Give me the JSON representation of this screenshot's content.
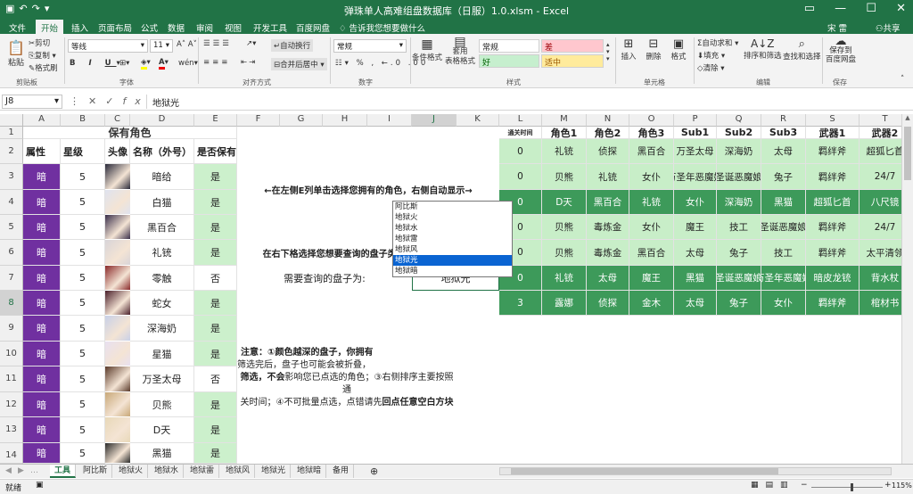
{
  "window": {
    "title": "弹珠单人高难组盘数据库（日服）1.0.xlsm - Excel",
    "user": "宋 雷",
    "share": "共享",
    "save_icon": "save-icon"
  },
  "ribbon_tabs": [
    "文件",
    "开始",
    "插入",
    "页面布局",
    "公式",
    "数据",
    "审阅",
    "视图",
    "开发工具",
    "百度网盘"
  ],
  "ribbon_tab_active": "开始",
  "tell_me": "告诉我您想要做什么",
  "ribbon": {
    "clipboard": {
      "paste": "粘贴",
      "cut": "剪切",
      "copy": "复制",
      "format_painter": "格式刷",
      "label": "剪贴板"
    },
    "font": {
      "name": "等线",
      "size": "11",
      "label": "字体"
    },
    "alignment": {
      "wrap": "自动换行",
      "merge": "合并后居中",
      "label": "对齐方式"
    },
    "number": {
      "format": "常规",
      "label": "数字"
    },
    "styles": {
      "cond": "条件格式",
      "table": "套用\n表格格式",
      "normal": "常规",
      "bad": "差",
      "good": "好",
      "neutral": "适中",
      "label": "样式"
    },
    "cells": {
      "insert": "插入",
      "delete": "删除",
      "format": "格式",
      "label": "单元格"
    },
    "editing": {
      "autosum": "自动求和",
      "fill": "填充",
      "clear": "清除",
      "sort": "排序和筛选",
      "find": "查找和选择",
      "label": "编辑"
    },
    "save": {
      "btn": "保存到\n百度网盘",
      "label": "保存"
    }
  },
  "formula_bar": {
    "cell": "J8",
    "value": "地狱光"
  },
  "columns": [
    "A",
    "B",
    "C",
    "D",
    "E",
    "F",
    "G",
    "H",
    "I",
    "J",
    "K",
    "L",
    "M",
    "N",
    "O",
    "P",
    "Q",
    "R",
    "S",
    "T"
  ],
  "rows": [
    "1",
    "2",
    "3",
    "4",
    "5",
    "6",
    "7",
    "8",
    "9",
    "10",
    "11",
    "12",
    "13",
    "14"
  ],
  "owned": {
    "title": "保有角色",
    "headers": [
      "属性",
      "星级",
      "头像",
      "名称（外号）",
      "是否保有"
    ],
    "rows": [
      [
        "暗",
        "5",
        "暗给",
        "是"
      ],
      [
        "暗",
        "5",
        "白猫",
        "是"
      ],
      [
        "暗",
        "5",
        "黑百合",
        "是"
      ],
      [
        "暗",
        "5",
        "礼铳",
        "是"
      ],
      [
        "暗",
        "5",
        "零触",
        "否"
      ],
      [
        "暗",
        "5",
        "蛇女",
        "是"
      ],
      [
        "暗",
        "5",
        "深海奶",
        "是"
      ],
      [
        "暗",
        "5",
        "星猫",
        "是"
      ],
      [
        "暗",
        "5",
        "万圣太母",
        "否"
      ],
      [
        "暗",
        "5",
        "贝熊",
        "是"
      ],
      [
        "暗",
        "5",
        "D天",
        "是"
      ],
      [
        "暗",
        "5",
        "黑猫",
        "是"
      ]
    ]
  },
  "instructions": {
    "line1": "←在左侧E列单击选择您拥有的角色，右侧自动显示→",
    "line2": "在右下格选择您想要查询的盘子类型，然后点一下E列",
    "query_label": "需要查询的盘子为:",
    "query_value": "地狱光",
    "note_l1": "注意：①颜色越深的盘子，你拥有",
    "note_l2": "筛选完后，盘子也可能会被折叠，",
    "note_l3a": "筛选，",
    "note_l3b": "不会",
    "note_l3c": "影响您已点选的角色；③右侧排序主要按照通",
    "note_l4a": "关时间；④不可批量点选，点错请先",
    "note_l4b": "回点任意空白方块"
  },
  "dropdown_options": [
    "阿比斯",
    "地狱火",
    "地狱水",
    "地狱雷",
    "地狱风",
    "地狱光",
    "地狱暗"
  ],
  "dropdown_selected": 5,
  "result": {
    "headers": [
      "通关时间",
      "角色1",
      "角色2",
      "角色3",
      "Sub1",
      "Sub2",
      "Sub3",
      "武器1",
      "武器2"
    ],
    "rows": [
      [
        "0",
        "礼铳",
        "侦探",
        "黑百合",
        "万圣太母",
        "深海奶",
        "太母",
        "羁绊斧",
        "超狐匕首"
      ],
      [
        "0",
        "贝熊",
        "礼铳",
        "女仆",
        "万圣年恶魔娘",
        "圣诞恶魔娘",
        "兔子",
        "羁绊斧",
        "24/7"
      ],
      [
        "0",
        "D天",
        "黑百合",
        "礼铳",
        "女仆",
        "深海奶",
        "黑猫",
        "超狐匕首",
        "八尺镜"
      ],
      [
        "0",
        "贝熊",
        "毒炼金",
        "女仆",
        "魔王",
        "技工",
        "圣诞恶魔娘",
        "羁绊斧",
        "24/7"
      ],
      [
        "0",
        "贝熊",
        "毒炼金",
        "黑百合",
        "太母",
        "兔子",
        "技工",
        "羁绊斧",
        "太平清领"
      ],
      [
        "0",
        "礼铳",
        "太母",
        "魔王",
        "黑猫",
        "圣诞恶魔娘",
        "万圣年恶魔娘",
        "暗皮龙铳",
        "背水杖"
      ],
      [
        "3",
        "露娜",
        "侦探",
        "金木",
        "太母",
        "兔子",
        "女仆",
        "羁绊斧",
        "棺材书"
      ]
    ]
  },
  "sheet_tabs": [
    "工具",
    "阿比斯",
    "地狱火",
    "地狱水",
    "地狱雷",
    "地狱风",
    "地狱光",
    "地狱暗",
    "备用"
  ],
  "sheet_active": 0,
  "status": {
    "ready": "就绪",
    "zoom": "115%"
  }
}
